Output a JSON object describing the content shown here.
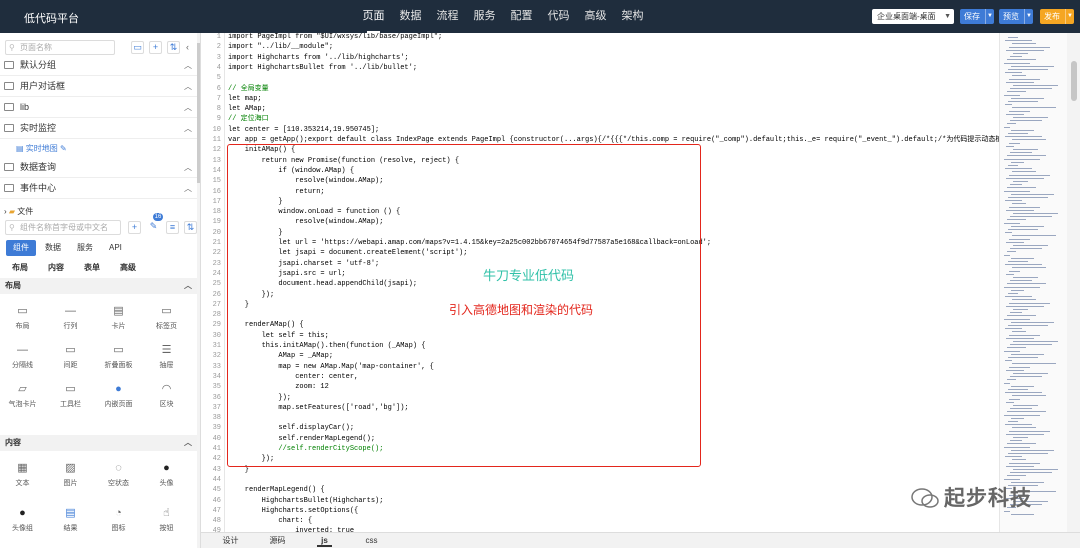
{
  "app": {
    "title": "低代码平台"
  },
  "nav": [
    "页面",
    "数据",
    "流程",
    "服务",
    "配置",
    "代码",
    "高级",
    "架构"
  ],
  "toolbar": {
    "env": "企业桌面端-桌面",
    "save": "保存",
    "preview": "预览",
    "publish": "发布"
  },
  "sidebar": {
    "search_placeholder": "页面名称",
    "groups": [
      "默认分组",
      "用户对话框",
      "lib",
      "实时监控",
      "数据查询",
      "事件中心"
    ],
    "page_item": "实时地图",
    "file_label": "文件",
    "comp_search_placeholder": "组件名称首字母或中文名",
    "badge": "16",
    "tabs": [
      "组件",
      "数据",
      "服务",
      "API"
    ],
    "subtabs": [
      "布局",
      "内容",
      "表单",
      "高级"
    ],
    "sections": [
      "布局",
      "内容"
    ],
    "layout_items": [
      "布局",
      "行列",
      "卡片",
      "标签页",
      "分隔线",
      "间距",
      "折叠面板",
      "抽屉",
      "气泡卡片",
      "工具栏",
      "内嵌页面",
      "区块"
    ],
    "content_items": [
      "文本",
      "图片",
      "空状态",
      "头像",
      "头像组",
      "结果",
      "图标",
      "按钮"
    ]
  },
  "editor": {
    "lines": [
      "import PageImpl from \"$UI/wxsys/lib/base/pageImpl\";",
      "import \"../lib/__module\";",
      "import Highcharts from '../lib/highcharts';",
      "import HighchartsBullet from '../lib/bullet';",
      "",
      "// 全局变量",
      "let map;",
      "let AMap;",
      "// 定位海口",
      "let center = [110.353214,19.950745];",
      "var app = getApp();export default class IndexPage extends PageImpl {constructor(...args){/*{{{*/this.comp = require(\"_comp\").default;this._e= require(\"_event_\").default;/*为代码提示动态植入的辅助",
      "    initAMap() {",
      "        return new Promise(function (resolve, reject) {",
      "            if (window.AMap) {",
      "                resolve(window.AMap);",
      "                return;",
      "            }",
      "            window.onLoad = function () {",
      "                resolve(window.AMap);",
      "            }",
      "            let url = 'https://webapi.amap.com/maps?v=1.4.15&key=2a25c002bb67074654f9d77587a5e168&callback=onLoad';",
      "            let jsapi = document.createElement('script');",
      "            jsapi.charset = 'utf-8';",
      "            jsapi.src = url;",
      "            document.head.appendChild(jsapi);",
      "        });",
      "    }",
      "",
      "    renderAMap() {",
      "        let self = this;",
      "        this.initAMap().then(function (_AMap) {",
      "            AMap = _AMap;",
      "            map = new AMap.Map('map-container', {",
      "                center: center,",
      "                zoom: 12",
      "            });",
      "            map.setFeatures(['road','bg']);",
      "",
      "            self.displayCar();",
      "            self.renderMapLegend();",
      "            //self.renderCityScope();",
      "        });",
      "    }",
      "",
      "    renderMapLegend() {",
      "        HighchartsBullet(Highcharts);",
      "        Highcharts.setOptions({",
      "            chart: {",
      "                inverted: true"
    ],
    "annotation_teal": "牛刀专业低代码",
    "annotation_red": "引入高德地图和渲染的代码"
  },
  "bottom_tabs": [
    "设计",
    "源码",
    "js",
    "css"
  ],
  "watermark": "起步科技",
  "colors": {
    "topbar": "#1f2d3d",
    "accent": "#3e7bd6",
    "publish": "#f5a623",
    "annotation_red": "#e3261c",
    "annotation_teal": "#31c1a8"
  }
}
